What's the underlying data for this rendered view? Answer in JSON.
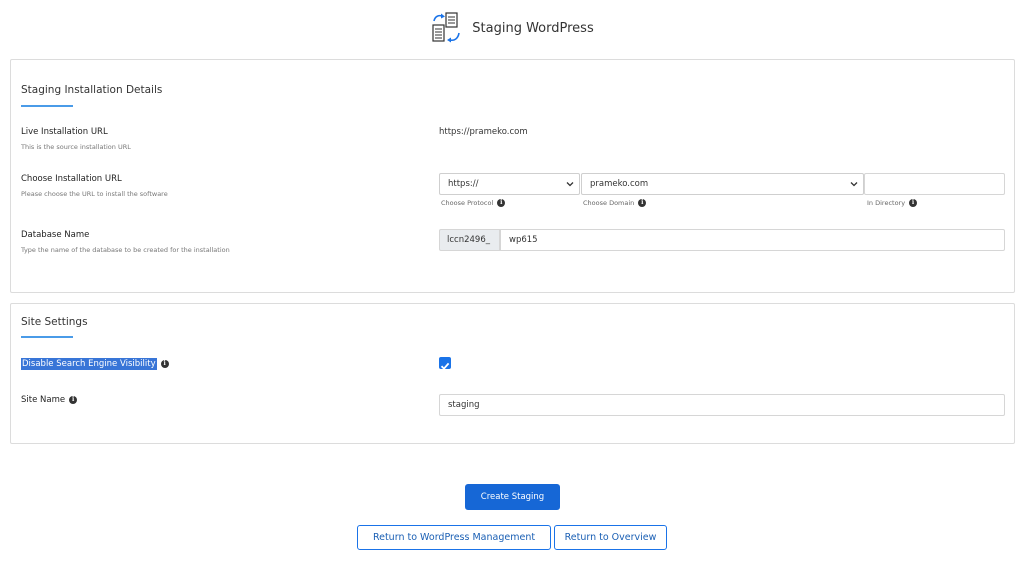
{
  "header": {
    "title": "Staging WordPress",
    "icon": "staging-copy-icon"
  },
  "details": {
    "title": "Staging Installation Details",
    "live_url": {
      "label": "Live Installation URL",
      "hint": "This is the source installation URL",
      "value": "https://prameko.com"
    },
    "install_url": {
      "label": "Choose Installation URL",
      "hint": "Please choose the URL to install the software",
      "protocol": "https://",
      "domain": "prameko.com",
      "directory": "",
      "protocol_label": "Choose Protocol",
      "domain_label": "Choose Domain",
      "directory_label": "In Directory"
    },
    "database": {
      "label": "Database Name",
      "hint": "Type the name of the database to be created for the installation",
      "prefix": "lccn2496_",
      "value": "wp615"
    }
  },
  "site": {
    "title": "Site Settings",
    "disable_seo": {
      "label": "Disable Search Engine Visibility",
      "checked": true
    },
    "site_name": {
      "label": "Site Name",
      "value": "staging"
    }
  },
  "actions": {
    "create": "Create Staging",
    "return_wp": "Return to WordPress Management",
    "return_overview": "Return to Overview"
  },
  "colors": {
    "primary": "#1667d6",
    "accent_underline": "#4a9be8",
    "checkbox": "#1a73e8"
  }
}
